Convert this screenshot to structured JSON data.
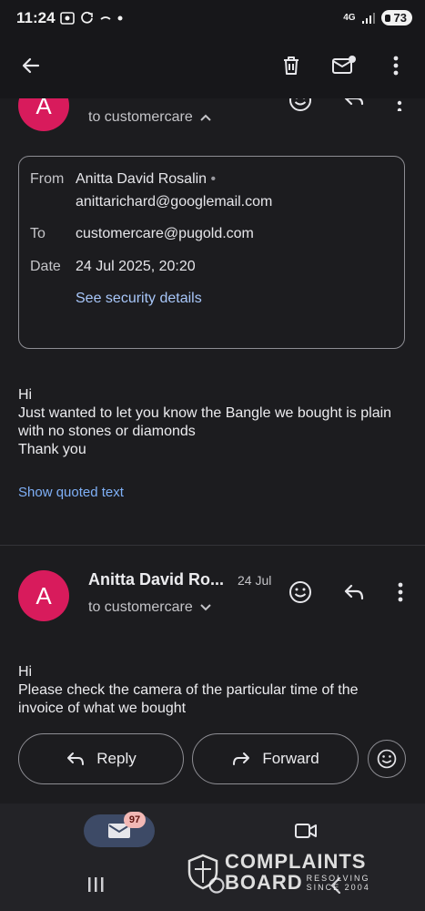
{
  "status_bar": {
    "time": "11:24",
    "network": "4G",
    "battery": "73"
  },
  "message1": {
    "avatar_letter": "A",
    "to_line": "to customercare",
    "details": {
      "from_label": "From",
      "from_name": "Anitta David Rosalin",
      "from_email": "anittarichard@googlemail.com",
      "to_label": "To",
      "to_value": "customercare@pugold.com",
      "date_label": "Date",
      "date_value": "24 Jul 2025, 20:20",
      "security_link": "See security details"
    },
    "body_lines": [
      "Hi",
      "Just wanted to let you know the Bangle we bought is plain",
      "with no stones or diamonds",
      "Thank you"
    ],
    "show_quoted": "Show quoted text"
  },
  "message2": {
    "avatar_letter": "A",
    "sender": "Anitta David Ro...",
    "date": "24 Jul",
    "to_line": "to customercare",
    "body_lines": [
      "Hi",
      "Please check the camera of the particular time of the",
      "invoice of what we bought"
    ]
  },
  "actions": {
    "reply": "Reply",
    "forward": "Forward"
  },
  "bottom_nav": {
    "mail_badge": "97"
  },
  "watermark": {
    "line1": "COMPLAINTS",
    "line2": "BOARD",
    "tag1": "RESOLVING",
    "tag2": "SINCE 2004"
  },
  "colors": {
    "background": "#1c1c1f",
    "avatar": "#d81b5c",
    "link": "#a8c7fa",
    "badge": "#f2b8b5"
  },
  "icons": [
    "back-arrow",
    "delete",
    "mark-unread",
    "more-vert",
    "emoji",
    "reply",
    "forward",
    "mail",
    "video"
  ]
}
